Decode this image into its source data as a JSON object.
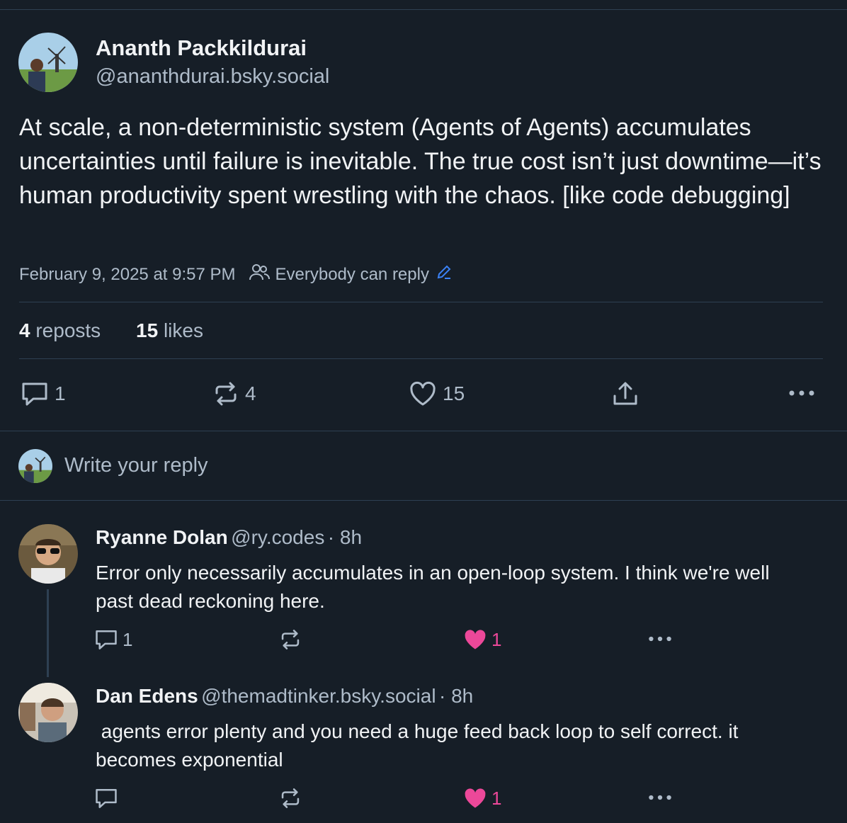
{
  "post": {
    "author_name": "Ananth Packkildurai",
    "author_handle": "@ananthdurai.bsky.social",
    "text": "At scale, a non-deterministic system (Agents of Agents) accumulates uncertainties until failure is inevitable. The true cost isn’t just downtime—it’s human productivity spent wrestling with the chaos. [like code debugging]",
    "timestamp": "February 9, 2025 at 9:57 PM",
    "reply_setting": "Everybody can reply",
    "stats": {
      "reposts_count": "4",
      "reposts_label": "reposts",
      "likes_count": "15",
      "likes_label": "likes"
    },
    "actions": {
      "reply_count": "1",
      "repost_count": "4",
      "like_count": "15"
    }
  },
  "composer": {
    "placeholder": "Write your reply"
  },
  "replies": [
    {
      "name": "Ryanne Dolan",
      "handle": "@ry.codes",
      "age": "· 8h",
      "text": "Error only necessarily accumulates in an open-loop system. I think we're well past dead reckoning here.",
      "reply_count": "1",
      "like_count": "1"
    },
    {
      "name": "Dan Edens",
      "handle": "@themadtinker.bsky.social",
      "age": "· 8h",
      "text": " agents error plenty and you need a huge feed back loop to self correct. it becomes exponential",
      "like_count": "1"
    }
  ],
  "colors": {
    "background": "#161e27",
    "accent": "#3b82f6",
    "like": "#ec4899",
    "muted": "#aebbc9"
  }
}
